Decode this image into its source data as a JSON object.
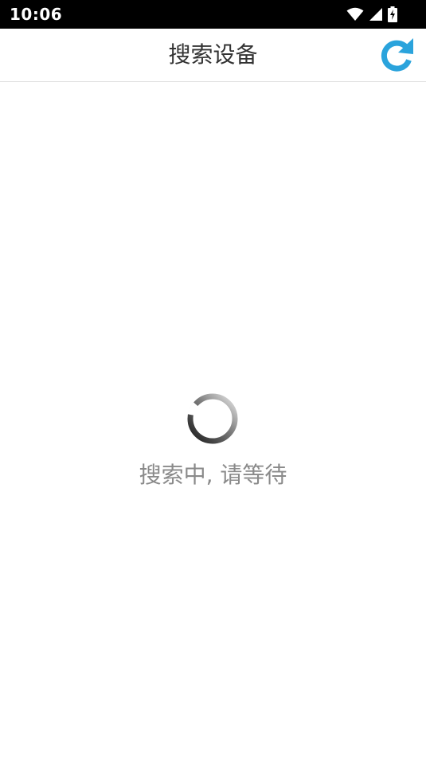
{
  "status_bar": {
    "time": "10:06",
    "icons": [
      "wifi-icon",
      "cellular-signal-icon",
      "battery-charging-icon"
    ]
  },
  "app_bar": {
    "title": "搜索设备",
    "refresh_icon": "refresh-icon",
    "accent_color": "#2aa3dc"
  },
  "content": {
    "loading_text": "搜索中, 请等待",
    "spinner_icon": "loading-spinner-icon"
  }
}
